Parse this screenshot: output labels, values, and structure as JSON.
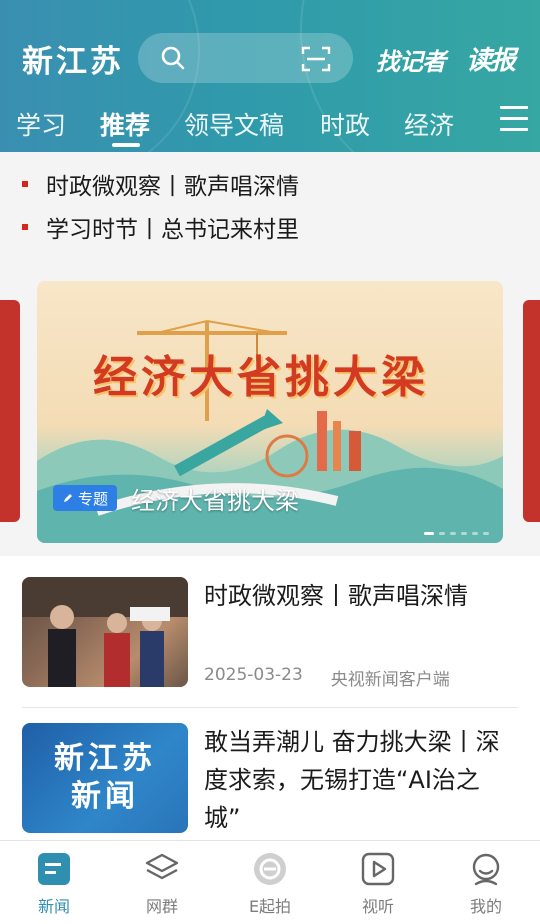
{
  "header": {
    "logo": "新江苏",
    "find_reporter": "找记者",
    "read_paper": "读报"
  },
  "tabs": [
    "学习",
    "推荐",
    "领导文稿",
    "时政",
    "经济"
  ],
  "active_tab": "推荐",
  "ticker": [
    "时政微观察丨歌声唱深情",
    "学习时节丨总书记来村里"
  ],
  "banner": {
    "art_title": "经济大省挑大梁",
    "badge": "专题",
    "caption": "经济大省挑大梁"
  },
  "news": [
    {
      "title": "时政微观察丨歌声唱深情",
      "date": "2025-03-23",
      "source": "央视新闻客户端"
    },
    {
      "title": "敢当弄潮儿  奋力挑大梁丨深度求索，无锡打造“AI治之城”",
      "thumb_text_1": "新江苏",
      "thumb_text_2": "新闻"
    }
  ],
  "bottom_nav": [
    {
      "label": "新闻",
      "icon": "news-icon"
    },
    {
      "label": "网群",
      "icon": "layers-icon"
    },
    {
      "label": "E起拍",
      "icon": "e-camera-icon"
    },
    {
      "label": "视听",
      "icon": "play-icon"
    },
    {
      "label": "我的",
      "icon": "profile-icon"
    }
  ],
  "colors": {
    "header_gradient_start": "#3a8fb1",
    "header_gradient_end": "#36a7a3",
    "ticker_dot": "#d6261c",
    "badge": "#2d7fe6",
    "nav_active": "#2f8fb0"
  }
}
